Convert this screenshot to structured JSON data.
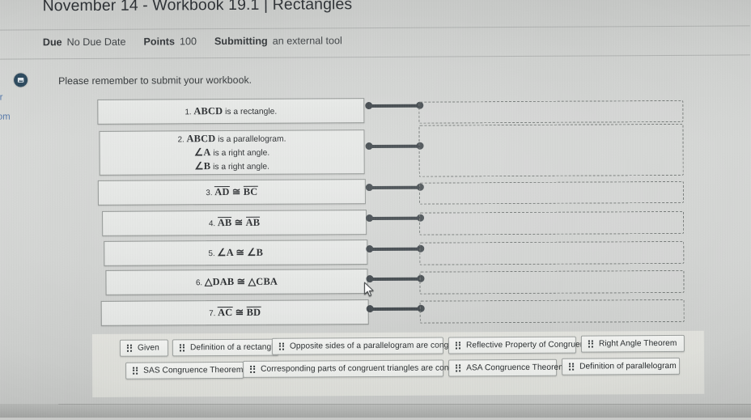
{
  "header": {
    "title": "November 14 - Workbook 19.1 | Rectangles",
    "meta": {
      "due_label": "Due",
      "due_value": "No Due Date",
      "points_label": "Points",
      "points_value": "100",
      "submitting_label": "Submitting",
      "submitting_value": "an external tool"
    },
    "notice": "Please remember to submit your workbook.",
    "badge_icon": "assignment-badge-icon"
  },
  "left_rail": {
    "items": [
      {
        "label": "er"
      },
      {
        "label": "oom"
      }
    ]
  },
  "proof": {
    "statements": [
      {
        "number": "1.",
        "lines": [
          {
            "math": "ABCD",
            "text": " is a rectangle."
          }
        ]
      },
      {
        "number": "2.",
        "lines": [
          {
            "math": "ABCD",
            "text": " is a parallelogram."
          },
          {
            "math": "∠A",
            "text": " is a right angle."
          },
          {
            "math": "∠B",
            "text": " is a right angle."
          }
        ]
      },
      {
        "number": "3.",
        "lines": [
          {
            "overline": "AD",
            "rel": " ≅ ",
            "overline2": "BC"
          }
        ]
      },
      {
        "number": "4.",
        "lines": [
          {
            "overline": "AB",
            "rel": " ≅ ",
            "overline2": "AB"
          }
        ]
      },
      {
        "number": "5.",
        "lines": [
          {
            "math": "∠A",
            "rel": " ≅ ",
            "math2": "∠B"
          }
        ]
      },
      {
        "number": "6.",
        "lines": [
          {
            "math": "△DAB",
            "rel": " ≅ ",
            "math2": "△CBA"
          }
        ]
      },
      {
        "number": "7.",
        "lines": [
          {
            "overline": "AC",
            "rel": " ≅ ",
            "overline2": "BD"
          }
        ]
      }
    ],
    "dropzone_placeholder": ""
  },
  "reason_tray": {
    "tiles": [
      {
        "label": "Given"
      },
      {
        "label": "Definition of a rectangle"
      },
      {
        "label": "Opposite sides of a parallelogram are congruent."
      },
      {
        "label": "Reflective Property of Congruence"
      },
      {
        "label": "Right Angle Theorem"
      },
      {
        "label": "SAS Congruence Theorem"
      },
      {
        "label": "Corresponding parts of congruent triangles are congruent."
      },
      {
        "label": "ASA Congruence Theorem"
      },
      {
        "label": "Definition of parallelogram"
      }
    ],
    "grip_icon": "drag-handle-icon"
  },
  "cursor": {
    "icon": "mouse-pointer-icon"
  },
  "colors": {
    "badge": "#29475c",
    "connector": "#3b4247",
    "dropzone_border": "#6f7472",
    "rail_link": "#4a6fa5"
  }
}
